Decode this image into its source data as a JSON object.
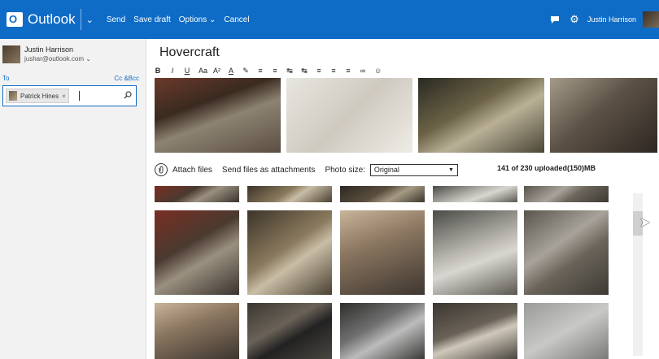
{
  "app": {
    "name": "Outlook",
    "commands": [
      "Send",
      "Save draft",
      "Options",
      "Cancel"
    ],
    "user_name": "Justin Harrison"
  },
  "sender": {
    "name": "Justin Harrison",
    "email": "jushar@outlook.com"
  },
  "recipients": {
    "to_label": "To",
    "ccbcc_label": "Cc &Bcc",
    "chip_name": "Patrick Hines",
    "chip_remove": "×"
  },
  "message": {
    "subject": "Hovercraft"
  },
  "format_toolbar": [
    "B",
    "I",
    "U",
    "Aa",
    "A²",
    "A",
    "✎",
    "≡",
    "≡",
    "↹",
    "↹",
    "≡",
    "≡",
    "≡",
    "∞",
    "☺"
  ],
  "attachments": {
    "attach_label": "Attach files",
    "send_as_label": "Send files as attachments",
    "photo_size_label": "Photo size:",
    "photo_size_value": "Original",
    "status": "141 of 230 uploaded(150)MB"
  },
  "icons": {
    "logo": "outlook-logo",
    "chat": "chat-icon",
    "settings": "gear-icon",
    "search": "search-icon",
    "paperclip": "paperclip-icon"
  },
  "colors": {
    "brand_blue": "#0f6cc6"
  }
}
